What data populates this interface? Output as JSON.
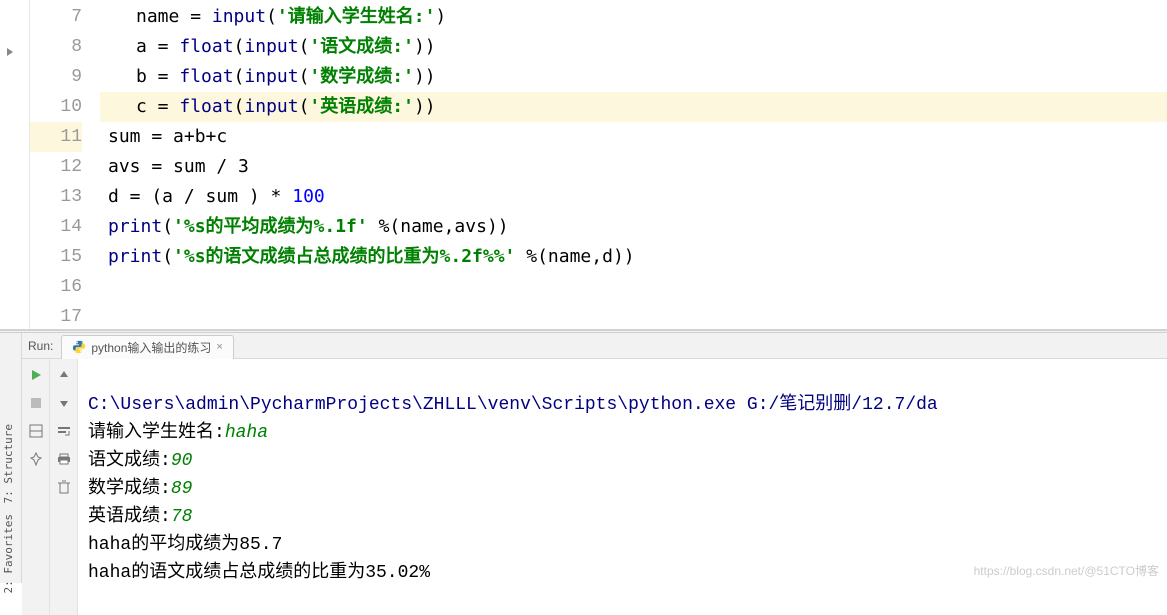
{
  "editor": {
    "line_numbers": [
      "7",
      "8",
      "9",
      "10",
      "11",
      "12",
      "13",
      "14",
      "15",
      "16",
      "17"
    ],
    "highlighted_line": 11,
    "lines": {
      "l8": {
        "var": "name",
        "eq": " = ",
        "fn": "input",
        "lp": "(",
        "str": "'请输入学生姓名:'",
        "rp": ")"
      },
      "l9": {
        "var": "a",
        "eq": " = ",
        "fn": "float",
        "lp": "(",
        "fn2": "input",
        "lp2": "(",
        "str": "'语文成绩:'",
        "rp2": ")",
        "rp": ")"
      },
      "l10": {
        "var": "b",
        "eq": " = ",
        "fn": "float",
        "lp": "(",
        "fn2": "input",
        "lp2": "(",
        "str": "'数学成绩:'",
        "rp2": ")",
        "rp": ")"
      },
      "l11": {
        "var": "c",
        "eq": " = ",
        "fn": "float",
        "lp": "(",
        "fn2": "input",
        "lp2": "(",
        "str": "'英语成绩:'",
        "rp2": ")",
        "rp": ")"
      },
      "l12": {
        "text": "sum = a+b+c"
      },
      "l13": {
        "text": "avs = sum / 3"
      },
      "l14": {
        "pre": "d = (a / sum ) * ",
        "num": "100"
      },
      "l15": {
        "fn": "print",
        "lp": "(",
        "str": "'%s的平均成绩为%.1f'",
        "mid": " %(name,avs)",
        "rp": ")"
      },
      "l16": {
        "fn": "print",
        "lp": "(",
        "str": "'%s的语文成绩占总成绩的比重为%.2f%%'",
        "mid": " %(name,d)",
        "rp": ")"
      }
    }
  },
  "run": {
    "label": "Run:",
    "tab_title": "python输入输出的练习",
    "console": {
      "cmd": "C:\\Users\\admin\\PycharmProjects\\ZHLLL\\venv\\Scripts\\python.exe G:/笔记别删/12.7/da",
      "p1_prompt": "请输入学生姓名:",
      "p1_input": "haha",
      "p2_prompt": "语文成绩:",
      "p2_input": "90",
      "p3_prompt": "数学成绩:",
      "p3_input": "89",
      "p4_prompt": "英语成绩:",
      "p4_input": "78",
      "out1": "haha的平均成绩为85.7",
      "out2": "haha的语文成绩占总成绩的比重为35.02%"
    }
  },
  "sidebar": {
    "structure": "7: Structure",
    "favorites": "2: Favorites"
  },
  "watermark": "https://blog.csdn.net/@51CTO博客"
}
